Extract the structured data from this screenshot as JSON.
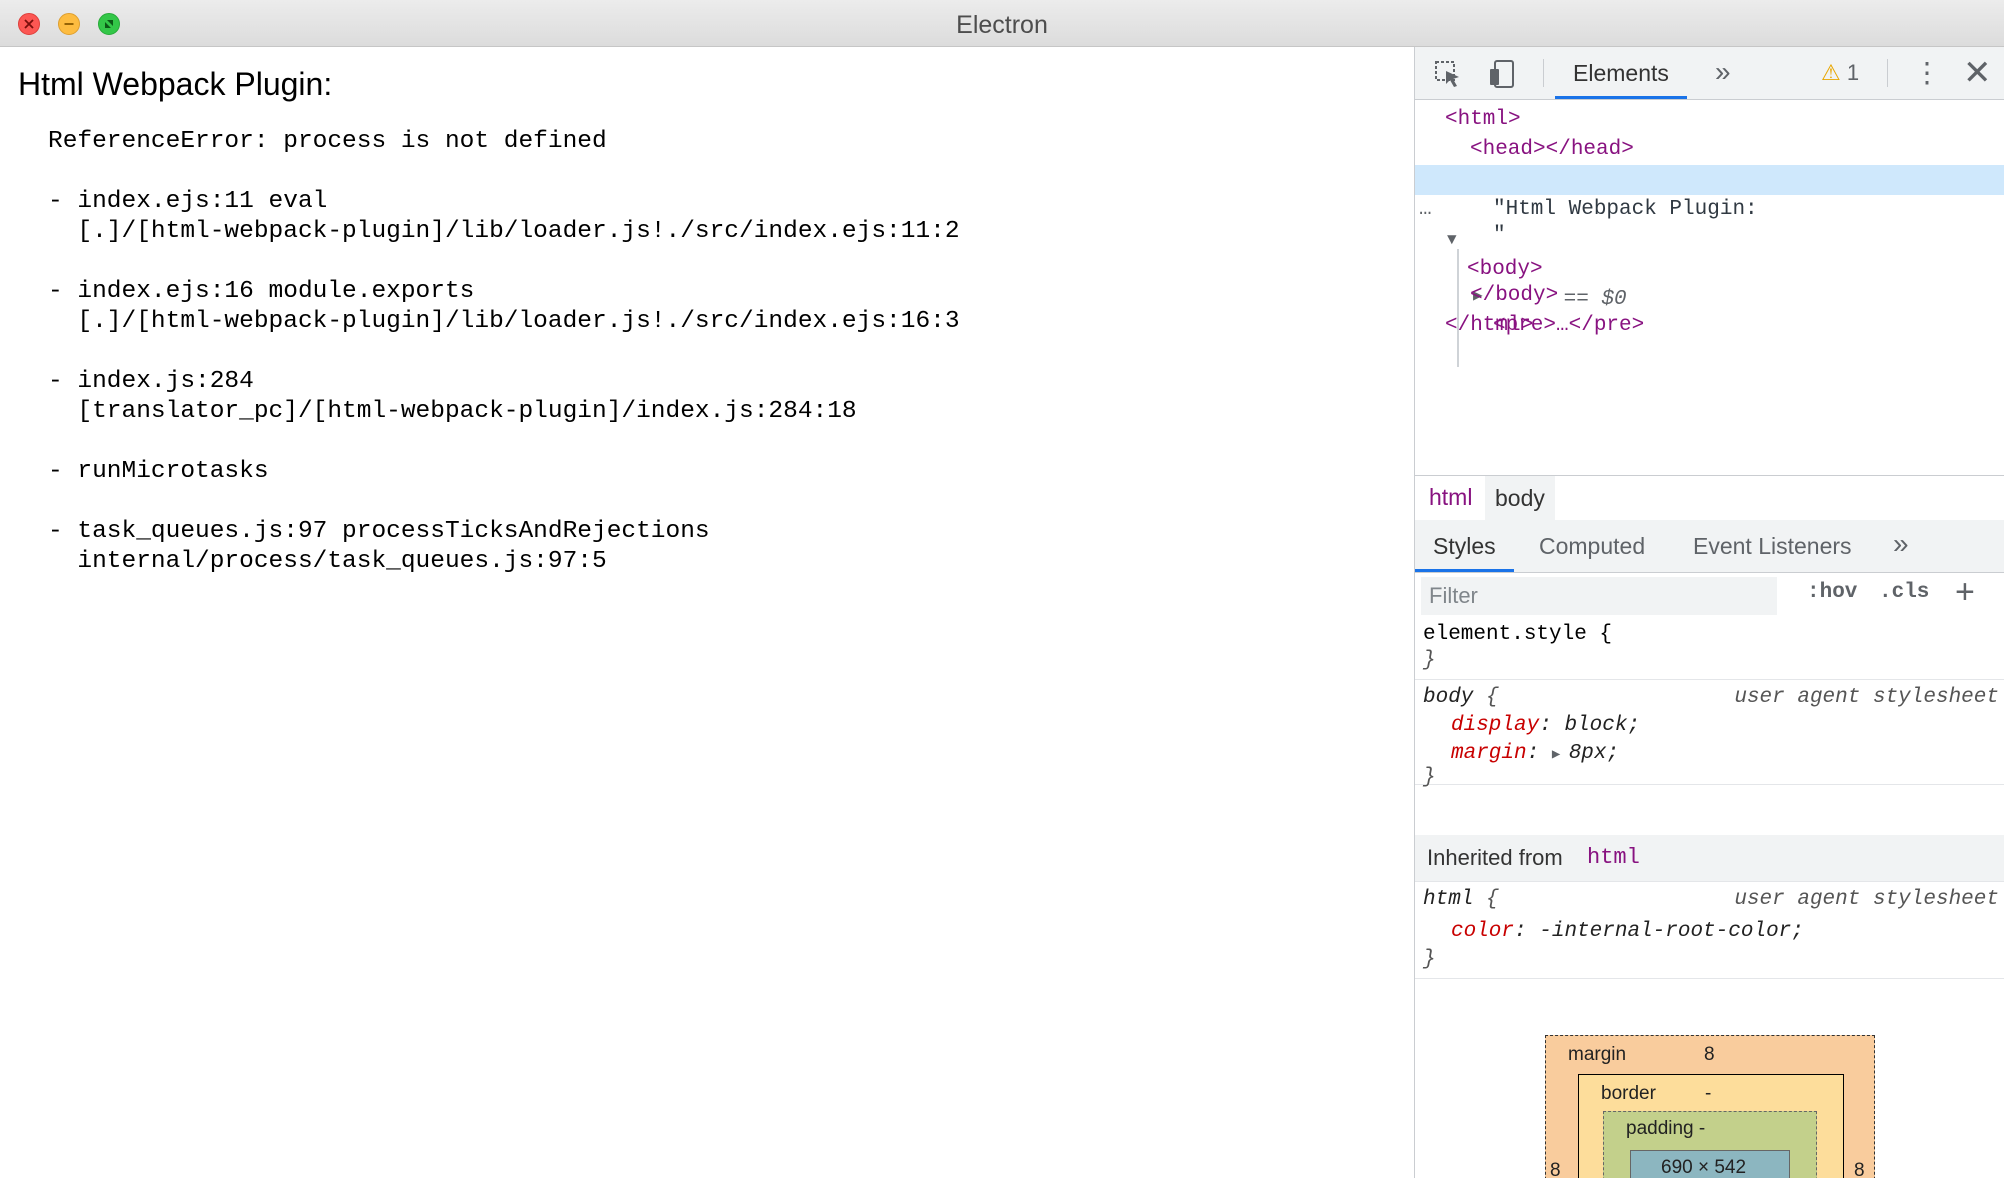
{
  "window": {
    "title": "Electron"
  },
  "page": {
    "heading": "Html Webpack Plugin:",
    "error_stack": "ReferenceError: process is not defined\n\n- index.ejs:11 eval\n  [.]/[html-webpack-plugin]/lib/loader.js!./src/index.ejs:11:2\n\n- index.ejs:16 module.exports\n  [.]/[html-webpack-plugin]/lib/loader.js!./src/index.ejs:16:3\n\n- index.js:284\n  [translator_pc]/[html-webpack-plugin]/index.js:284:18\n\n- runMicrotasks\n\n- task_queues.js:97 processTicksAndRejections\n  internal/process/task_queues.js:97:5"
  },
  "devtools": {
    "toolbar": {
      "active_tab": "Elements",
      "more": "»",
      "warning_count": "1",
      "close": "✕"
    },
    "dom": {
      "html_open": "<html>",
      "head": "<head></head>",
      "body_dots": "…",
      "body_open": "<body>",
      "body_marker": " == $0",
      "text_line1": "\"Html Webpack Plugin:",
      "text_line2": "\"",
      "pre": "<pre>…</pre>",
      "body_close": "</body>",
      "html_close": "</html>"
    },
    "breadcrumbs": [
      "html",
      "body"
    ],
    "subtabs": [
      "Styles",
      "Computed",
      "Event Listeners",
      "»"
    ],
    "filter": {
      "placeholder": "Filter",
      "hov": ":hov",
      "cls": ".cls",
      "add": "+"
    },
    "styles": {
      "element_style": {
        "selector": "element.style {",
        "close": "}"
      },
      "body_rule": {
        "selector": "body",
        "open": " {",
        "source": "user agent stylesheet",
        "props": [
          {
            "name": "display",
            "value": "block;"
          },
          {
            "name": "margin",
            "value": "8px;"
          }
        ],
        "close": "}"
      },
      "inherited": {
        "label": "Inherited from",
        "tag": "html"
      },
      "html_rule": {
        "selector": "html",
        "open": " {",
        "source": "user agent stylesheet",
        "props": [
          {
            "name": "color",
            "value": "-internal-root-color;"
          }
        ],
        "close": "}"
      }
    },
    "box_model": {
      "margin_label": "margin",
      "margin_value": "8",
      "border_label": "border",
      "border_value": "-",
      "padding_label": "padding -",
      "side_value": "8",
      "content_size": "690 × 542"
    }
  }
}
